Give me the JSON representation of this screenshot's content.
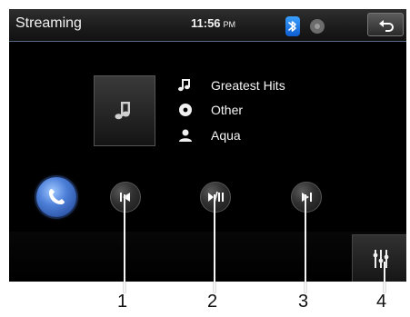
{
  "header": {
    "title": "Streaming",
    "time": "11:56",
    "ampm": "PM"
  },
  "track": {
    "song": "Greatest Hits",
    "genre": "Other",
    "artist": "Aqua"
  },
  "controls": {
    "prev": "previous-track",
    "playpause": "play-pause",
    "next": "next-track",
    "phone": "phone",
    "equalizer": "equalizer"
  },
  "callouts": {
    "labels": [
      "1",
      "2",
      "3",
      "4"
    ]
  },
  "colors": {
    "background": "#000000",
    "text": "#f5f5f5",
    "accent": "#1e88ff",
    "header_line": "#5a6a8a"
  }
}
